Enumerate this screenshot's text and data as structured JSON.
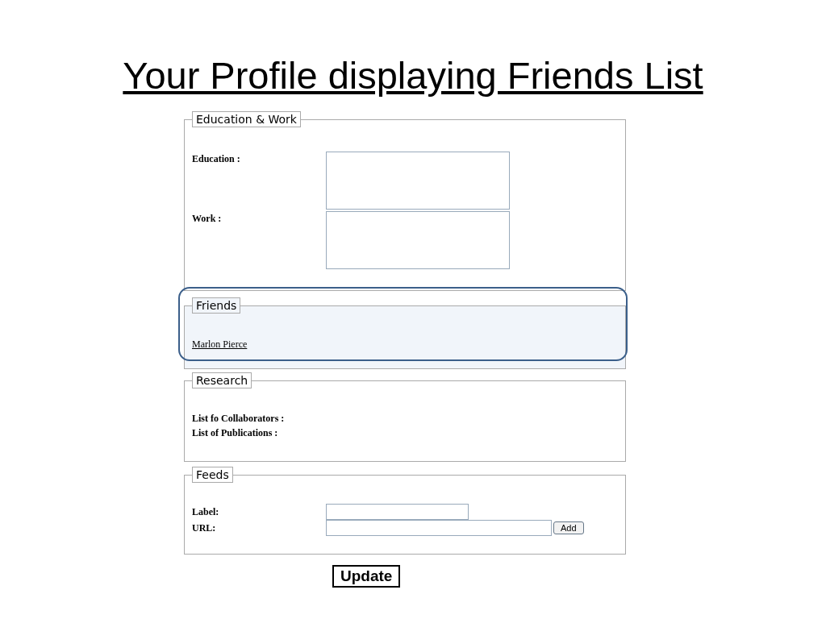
{
  "title": "Your Profile displaying Friends List",
  "sections": [
    {
      "legend": "Education & Work",
      "kind": "textareas",
      "rows": [
        {
          "label": "Education :"
        },
        {
          "label": "Work :"
        }
      ]
    },
    {
      "legend": "Friends",
      "kind": "links",
      "highlighted": true,
      "links": [
        "Marlon Pierce"
      ]
    },
    {
      "legend": "Research",
      "kind": "labels",
      "labels": [
        "List fo Collaborators :",
        "List of Publications :"
      ]
    },
    {
      "legend": "Feeds",
      "kind": "inputs",
      "rows": [
        {
          "label": "Label:"
        },
        {
          "label": "URL:",
          "button": "Add"
        }
      ]
    }
  ],
  "submit": "Update"
}
